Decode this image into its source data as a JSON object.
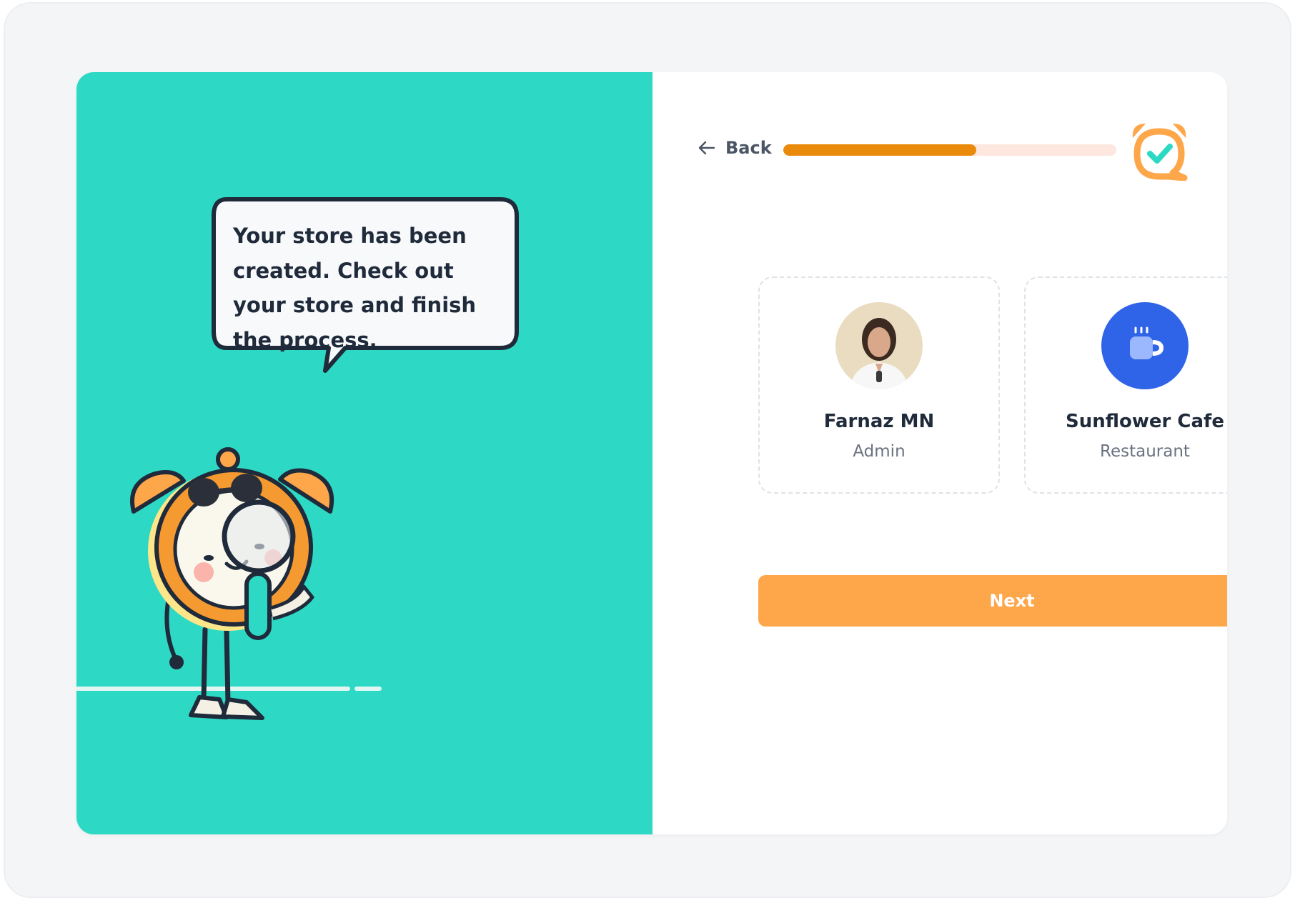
{
  "illustration": {
    "speech_bubble_text": "Your store has been created. Check out your store and finish the process.",
    "mascot": "alarm-clock-mascot-with-magnifier"
  },
  "header": {
    "back_label": "Back",
    "back_icon": "arrow-left-icon",
    "progress_fraction": 0.58,
    "logo": "alarm-clock-check-logo"
  },
  "cards": {
    "user": {
      "name": "Farnaz MN",
      "role": "Admin",
      "avatar": "user-photo"
    },
    "store": {
      "name": "Sunflower Cafe",
      "role": "Restaurant",
      "icon": "coffee-cup-icon"
    }
  },
  "actions": {
    "next_label": "Next"
  },
  "colors": {
    "teal": "#2dd9c4",
    "orange": "#fea64a",
    "progress": "#ea8a0a",
    "progress_track": "#fde7de",
    "store_icon_bg": "#2f63e8",
    "text_dark": "#1f2a3a",
    "text_muted": "#6b7280"
  }
}
